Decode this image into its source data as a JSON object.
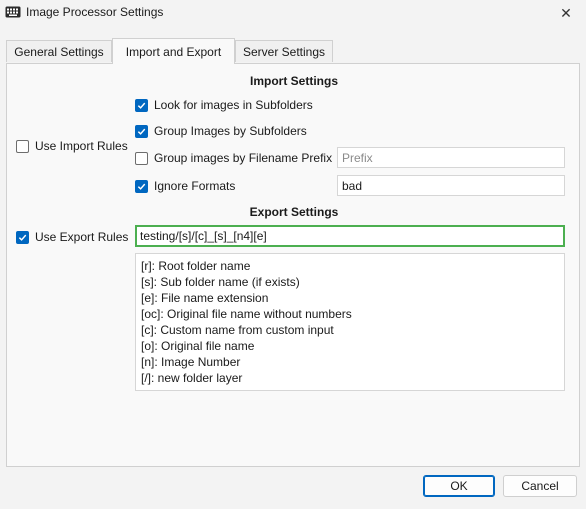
{
  "window": {
    "title": "Image Processor Settings",
    "close_glyph": "✕"
  },
  "tabs": [
    {
      "label": "General Settings",
      "active": false
    },
    {
      "label": "Import and Export",
      "active": true
    },
    {
      "label": "Server Settings",
      "active": false
    }
  ],
  "import": {
    "section_title": "Import Settings",
    "use_rules": {
      "label": "Use Import Rules",
      "checked": false
    },
    "options": [
      {
        "label": "Look for images in Subfolders",
        "checked": true
      },
      {
        "label": "Group Images by Subfolders",
        "checked": true
      },
      {
        "label": "Group images by Filename Prefix",
        "checked": false
      },
      {
        "label": "Ignore Formats",
        "checked": true
      }
    ],
    "prefix_field": {
      "value": "",
      "placeholder": "Prefix"
    },
    "ignore_formats_field": {
      "value": "bad"
    }
  },
  "export": {
    "section_title": "Export Settings",
    "use_rules": {
      "label": "Use Export Rules",
      "checked": true
    },
    "pattern_field": {
      "value": "testing/[s]/[c]_[s]_[n4][e]"
    },
    "rules_help": [
      "[r]: Root folder name",
      "[s]: Sub folder name (if exists)",
      "[e]: File name extension",
      "[oc]: Original file name without numbers",
      "[c]: Custom name from custom input",
      "[o]: Original file name",
      "[n]: Image Number",
      "[/]: new folder layer"
    ]
  },
  "footer": {
    "ok_label": "OK",
    "cancel_label": "Cancel"
  },
  "colors": {
    "accent": "#0067c0",
    "focus_border": "#4caf50"
  }
}
